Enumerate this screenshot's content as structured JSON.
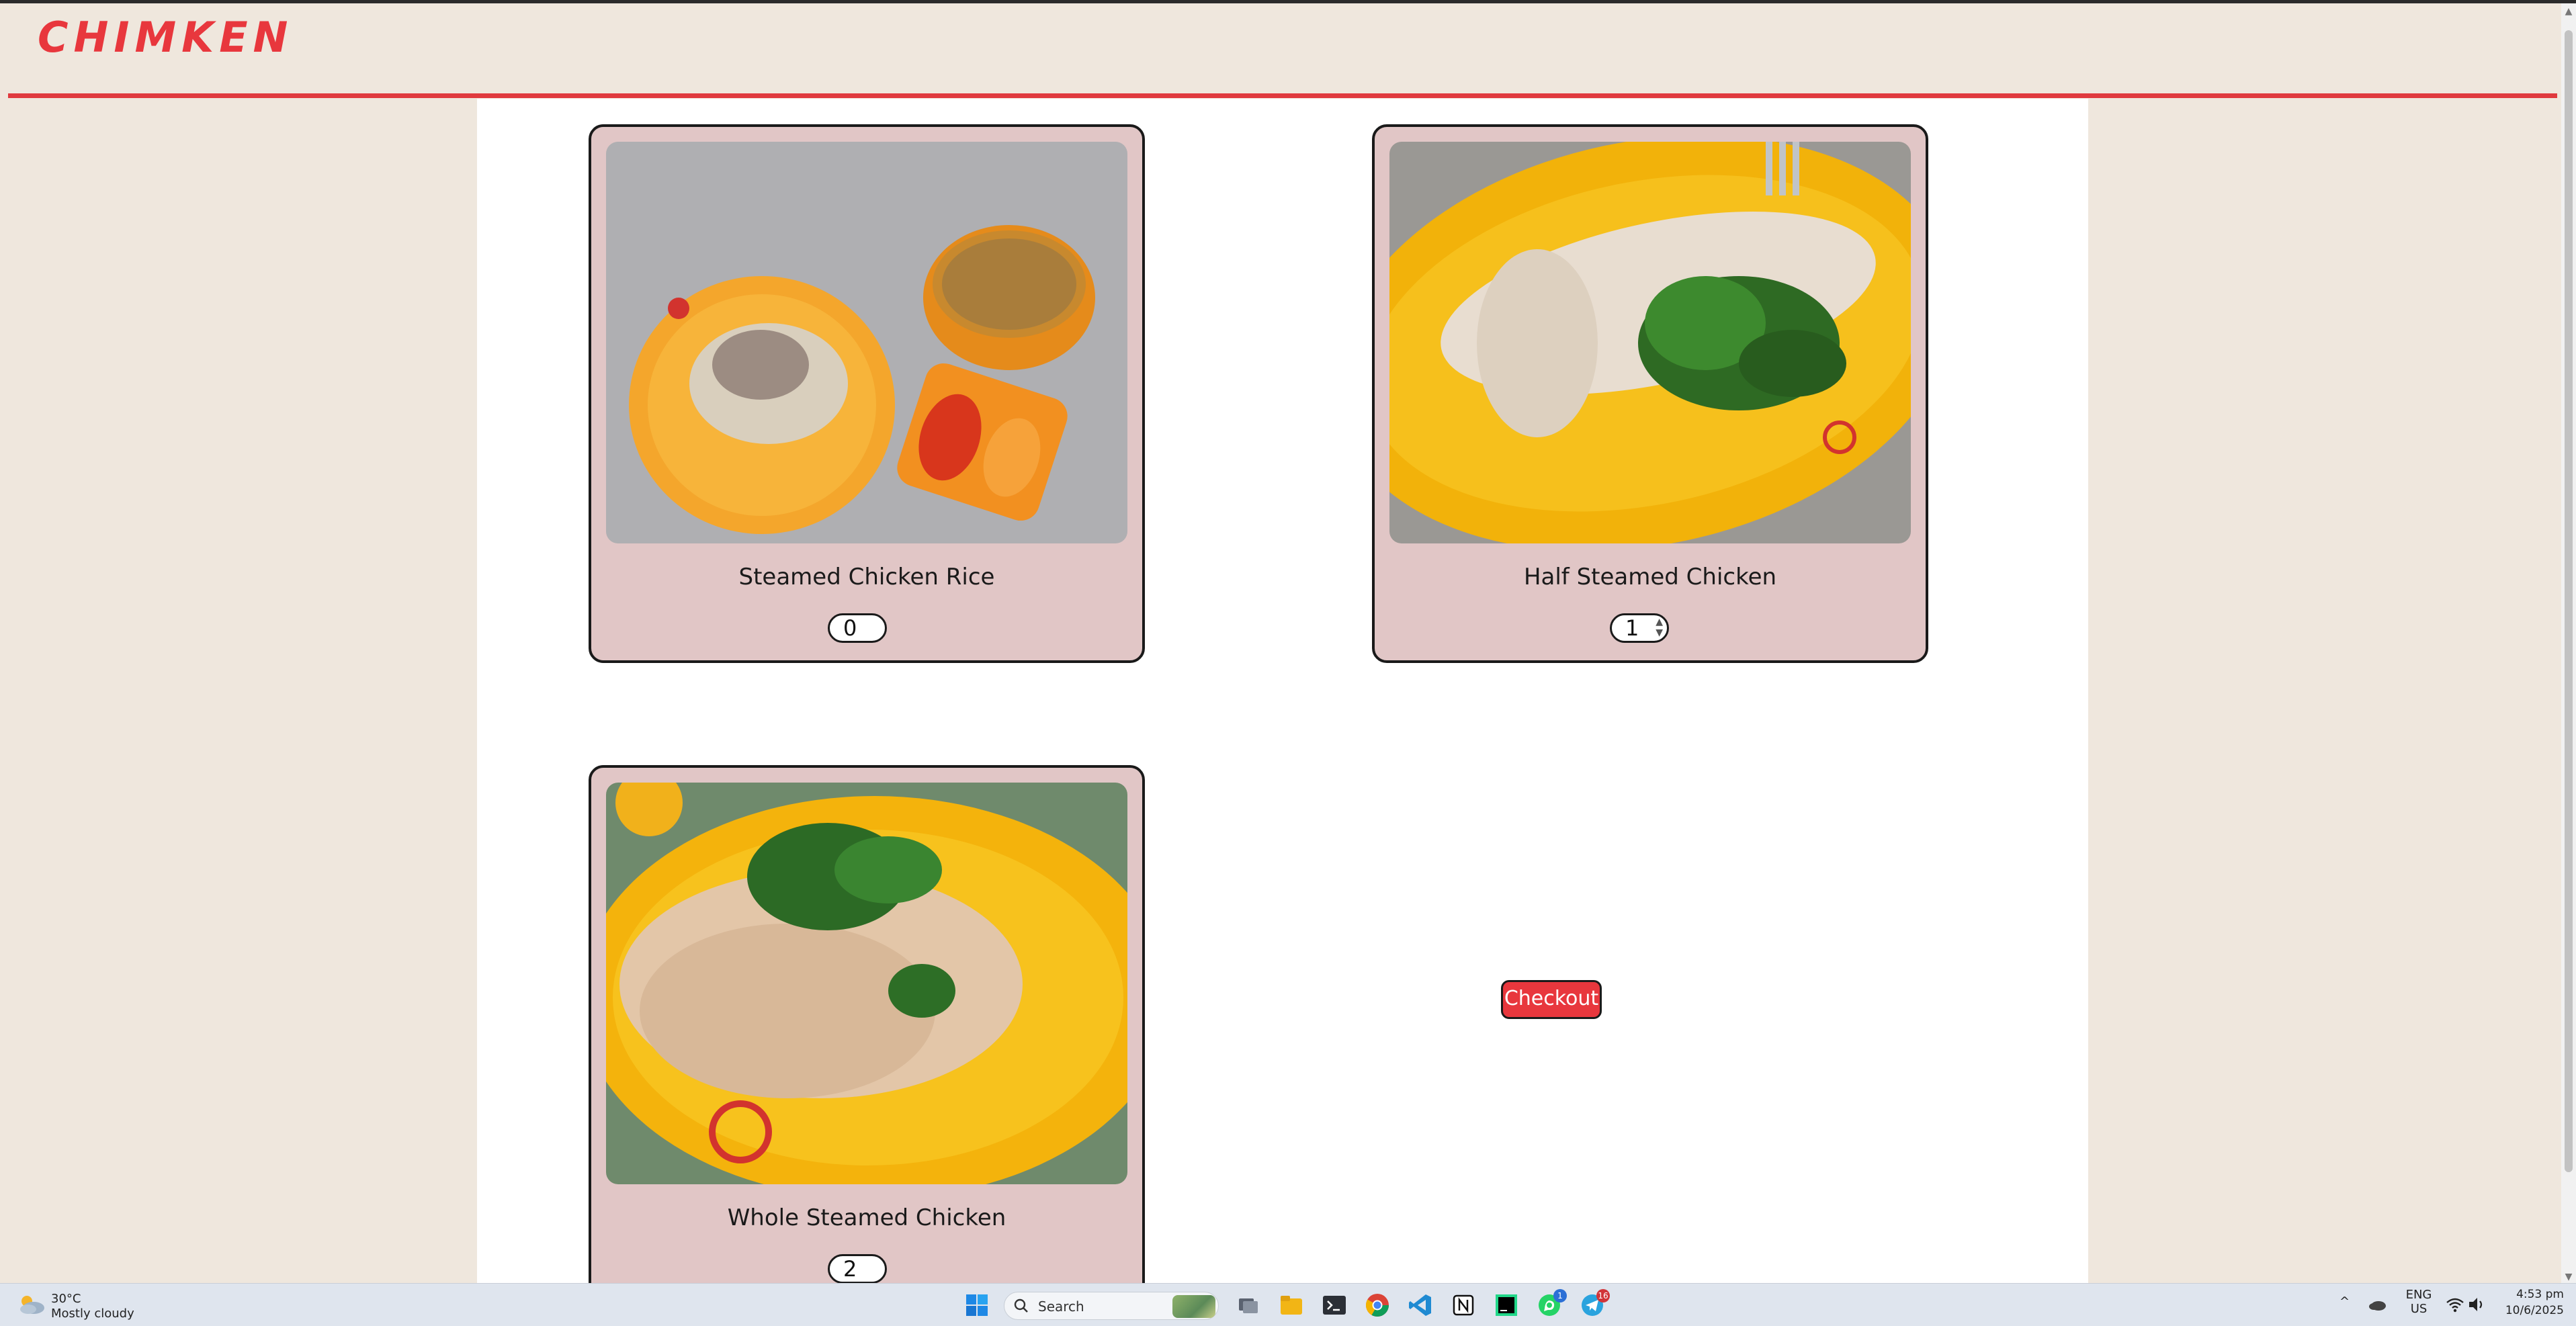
{
  "app": {
    "logo": "CHIMKEN"
  },
  "products": [
    {
      "name": "Steamed Chicken Rice",
      "quantity": "0"
    },
    {
      "name": "Half Steamed Chicken",
      "quantity": "1"
    },
    {
      "name": "Whole Steamed Chicken",
      "quantity": "2"
    }
  ],
  "checkout": {
    "label": "Checkout"
  },
  "colors": {
    "brand": "#e8373d",
    "card": "#e1c6c6",
    "background": "#efe7dd"
  },
  "taskbar": {
    "weather": {
      "temp": "30°C",
      "condition": "Mostly cloudy"
    },
    "search_label": "Search",
    "lang_line1": "ENG",
    "lang_line2": "US",
    "time": "4:53 pm",
    "date": "10/6/2025",
    "whatsapp_badge": "1",
    "telegram_badge": "16",
    "icons": [
      "windows-start-icon",
      "search-icon",
      "task-view-icon",
      "file-explorer-icon",
      "terminal-icon",
      "chrome-icon",
      "vscode-icon",
      "notion-icon",
      "pycharm-icon",
      "whatsapp-icon",
      "telegram-icon"
    ]
  }
}
